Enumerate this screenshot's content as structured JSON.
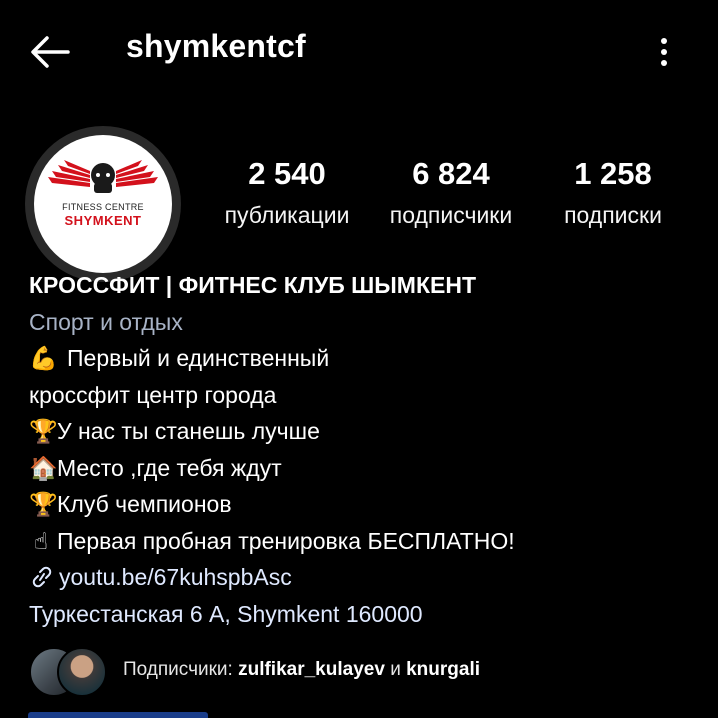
{
  "header": {
    "username": "shymkentcf",
    "back_icon": "arrow-left-icon",
    "more_icon": "more-vertical-icon"
  },
  "avatar": {
    "logo_top": "FITNESS CENTRE",
    "logo_name": "SHYMKENT",
    "accent": "#d3111c"
  },
  "stats": [
    {
      "value": "2 540",
      "label": "публикации"
    },
    {
      "value": "6 824",
      "label": "подписчики"
    },
    {
      "value": "1 258",
      "label": "подписки"
    }
  ],
  "bio": {
    "name": "КРОССФИТ | ФИТНЕС КЛУБ ШЫМКЕНТ",
    "category": "Спорт и отдых",
    "line1_emoji": "💪",
    "line1": "Первый и единственный",
    "line2": "кроссфит центр города",
    "line3_emoji": "🏆",
    "line3": "У нас ты станешь лучше",
    "line4_emoji": "🏠",
    "line4": "Место ,где тебя ждут",
    "line5_emoji": "🏆",
    "line5": "Клуб чемпионов",
    "line6_emoji": "☝",
    "line6": "Первая пробная тренировка БЕСПЛАТНО!",
    "link_icon": "link-icon",
    "link": "youtu.be/67kuhspbAsc",
    "address": "Туркестанская 6 А, Shymkent 160000"
  },
  "followers": {
    "prefix": "Подписчики:",
    "user1": "zulfikar_kulayev",
    "conj": "и",
    "user2": "knurgali"
  },
  "colors": {
    "background": "#000000",
    "category": "#a8b3c6",
    "link": "#dfe9ff"
  }
}
